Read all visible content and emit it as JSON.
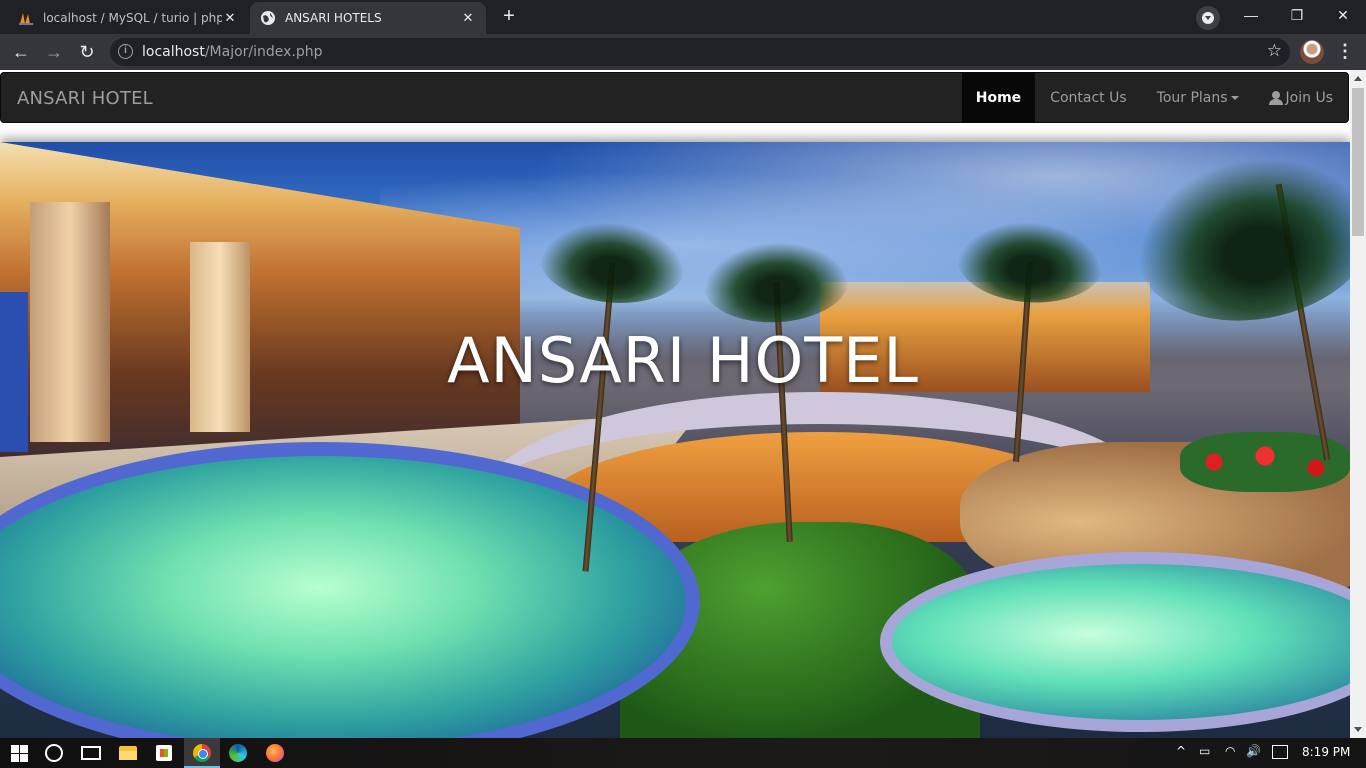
{
  "browser": {
    "tabs": [
      {
        "title": "localhost / MySQL / turio | phpM",
        "close": "✕",
        "icon": "phpmyadmin-icon"
      },
      {
        "title": "ANSARI HOTELS",
        "close": "✕",
        "icon": "globe-icon"
      }
    ],
    "new_tab": "+",
    "window_controls": {
      "minimize": "—",
      "restore": "❐",
      "close": "✕"
    },
    "nav": {
      "back": "←",
      "forward": "→",
      "reload": "↻"
    },
    "address": {
      "host": "localhost",
      "path": "/Major/index.php",
      "info": "i"
    },
    "bookmark": "☆",
    "menu": "⋮"
  },
  "site": {
    "brand": "ANSARI HOTEL",
    "nav": [
      {
        "label": "Home",
        "active": true
      },
      {
        "label": "Contact Us",
        "active": false
      },
      {
        "label": "Tour Plans",
        "active": false,
        "dropdown": true
      },
      {
        "label": "Join Us",
        "active": false,
        "icon": "user-icon"
      }
    ],
    "hero_title": "ANSARI HOTEL"
  },
  "taskbar": {
    "tray": {
      "chevron": "^",
      "battery": "▭",
      "wifi": "◠",
      "volume": "🔊"
    },
    "clock": "8:19 PM"
  }
}
